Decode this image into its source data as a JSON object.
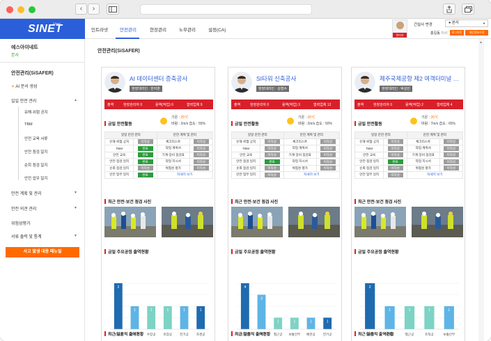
{
  "browser": {
    "back": "‹",
    "forward": "›"
  },
  "brand": {
    "logo_text": "SINET",
    "logo_sub": "Cloud"
  },
  "sidebar": {
    "company": "에스아이네트",
    "branch": "본사",
    "section": "안전관리(SiSAFER)",
    "ai": "AI 문서 생성",
    "group1": "일일 안전 관리",
    "sub": [
      "유해·위험 공지",
      "TBM",
      "안전 교육 서류",
      "안전 점검 일지",
      "순회 점검 일지",
      "안전 업무 일지"
    ],
    "group2": "안전 계획 및 관리",
    "group3": "안전 의견 관리",
    "group4": "위험성평가",
    "group5": "서류 출력 및 통계",
    "emergency": "사고 발생 대응 매뉴얼"
  },
  "topnav": {
    "tabs": [
      "인트라넷",
      "안전관리",
      "현장관리",
      "노무관리",
      "설정(CA)"
    ],
    "active": 1,
    "user_badge": "관리자",
    "site_label": "건설사 변경",
    "site_select": "● 본사",
    "user_name": "홍길동",
    "user_role": "이사",
    "logout": "로그아웃",
    "profile": "개인정보수정"
  },
  "page_title": "안전관리(SiSAFER)",
  "cards": [
    {
      "title": "AI 데이터센터 증축공사",
      "rep": "현장대리인 : 한지훈",
      "status": [
        "출역",
        "현장관리자 0",
        "용역(작업) 0",
        "협력업체 9"
      ],
      "weather": {
        "temp_label": "기온 : ",
        "temp": "25℃",
        "wind": "바람 : 2m/s",
        "humidity": "습도 : 55%"
      },
      "chart": {
        "categories": [
          "설비공",
          "철근공",
          "수장공",
          "미장공",
          "전기공",
          "조경공"
        ],
        "values": [
          2,
          1,
          1,
          1,
          1,
          1
        ]
      }
    },
    {
      "title": "SI타워 신축공사",
      "rep": "현장대리인 : 김형수",
      "status": [
        "출역",
        "현장관리자 0",
        "용역(작업) 3",
        "협력업체 12"
      ],
      "weather": {
        "temp_label": "기온 : ",
        "temp": "26℃",
        "wind": "바람 : 2m/s",
        "humidity": "습도 : 50%"
      },
      "chart": {
        "categories": [
          "내선전공",
          "비계공",
          "철근공",
          "보통인부",
          "배관공",
          "전기공"
        ],
        "values": [
          4,
          3,
          1,
          1,
          1,
          1
        ]
      }
    },
    {
      "title": "제주국제공항 제2 여객터미널 신...",
      "rep": "현장대리인 : 박성민",
      "status": [
        "출역",
        "현장관리자 0",
        "용역(작업) 2",
        "협력업체 4"
      ],
      "weather": {
        "temp_label": "기온 : ",
        "temp": "26℃",
        "wind": "바람 : 7m/s",
        "humidity": "습도 : 65%"
      },
      "chart": {
        "categories": [
          "설비공",
          "비계공",
          "철근공",
          "조적공",
          "보통인부"
        ],
        "values": [
          2,
          1,
          1,
          1,
          1
        ]
      }
    }
  ],
  "sections": {
    "activity": "금일 안전활동",
    "photos": "최근 안전·보건 점검 사진",
    "attendance": "금일 주요공정 출역현황",
    "daily": "최근 일용직 출역현황"
  },
  "mgmt": {
    "head": [
      "일일 안전 관리",
      "안전 계획 및 관리"
    ],
    "rows": [
      [
        "유해·위험 공지",
        "미작성",
        "체크리스트",
        "미작성"
      ],
      [
        "TBM",
        "완료",
        "작업 계획서",
        "미작성"
      ],
      [
        "안전 교육",
        "완료",
        "기계·장비 점검표",
        "미작성"
      ],
      [
        "안전 점검 일지",
        "완료",
        "작업 지시서",
        "미작성"
      ],
      [
        "순회 점검 일지",
        "미작성",
        "위험성 평가",
        "미작성"
      ],
      [
        "안전 업무 일지",
        "완료",
        "자세히 보기",
        ""
      ]
    ],
    "rows_card2": [
      [
        "유해·위험 공지",
        "미작성",
        "체크리스트",
        "미작성"
      ],
      [
        "TBM",
        "미작성",
        "작업 계획서",
        "미작성"
      ],
      [
        "안전 교육",
        "미작성",
        "기계·장비 점검표",
        "미작성"
      ],
      [
        "안전 점검 일지",
        "완료",
        "작업 지시서",
        "미작성"
      ],
      [
        "순회 점검 일지",
        "미작성",
        "위험성 평가",
        "미작성"
      ],
      [
        "안전 업무 일지",
        "미작성",
        "자세히 보기",
        ""
      ]
    ],
    "rows_card3": [
      [
        "유해·위험 공지",
        "미작성",
        "체크리스트",
        "미작성"
      ],
      [
        "TBM",
        "미작성",
        "작업 계획서",
        "미작성"
      ],
      [
        "안전 교육",
        "미작성",
        "기계·장비 점검표",
        "미작성"
      ],
      [
        "안전 점검 일지",
        "완료",
        "작업 지시서",
        "미작성"
      ],
      [
        "순회 점검 일지",
        "미작성",
        "위험성 평가",
        "미작성"
      ],
      [
        "안전 업무 일지",
        "미작성",
        "자세히 보기",
        ""
      ]
    ]
  },
  "chart_data": [
    {
      "type": "bar",
      "title": "금일 주요공정 출역현황",
      "categories": [
        "설비공",
        "철근공",
        "수장공",
        "미장공",
        "전기공",
        "조경공"
      ],
      "values": [
        2,
        1,
        1,
        1,
        1,
        1
      ]
    },
    {
      "type": "bar",
      "title": "금일 주요공정 출역현황",
      "categories": [
        "내선전공",
        "비계공",
        "철근공",
        "보통인부",
        "배관공",
        "전기공"
      ],
      "values": [
        4,
        3,
        1,
        1,
        1,
        1
      ]
    },
    {
      "type": "bar",
      "title": "금일 주요공정 출역현황",
      "categories": [
        "설비공",
        "비계공",
        "철근공",
        "조적공",
        "보통인부"
      ],
      "values": [
        2,
        1,
        1,
        1,
        1
      ]
    }
  ],
  "colors": {
    "brand": "#2b5fd9",
    "alert": "#d8202a",
    "orange": "#ff6a00",
    "ok": "#2b9c3d",
    "bar_dark": "#1f6bb0",
    "bar_light": "#5fb4e6",
    "bar_teal": "#7dd3c4"
  }
}
